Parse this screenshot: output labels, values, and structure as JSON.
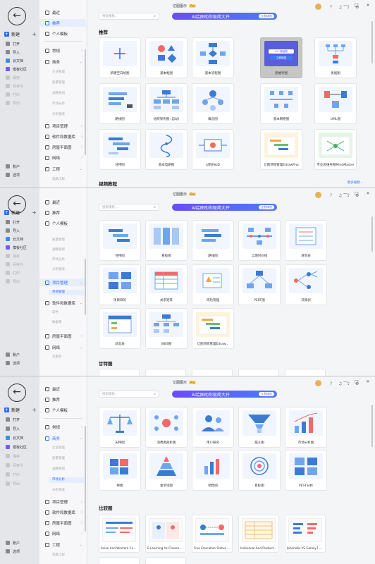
{
  "window": {
    "title": "亿图图示",
    "pro_badge": "Pro"
  },
  "rail": {
    "back_glyph": "←",
    "new_label": "新建",
    "new_plus": "+",
    "items": [
      {
        "label": "打开"
      },
      {
        "label": "导入"
      },
      {
        "label": "云文档"
      },
      {
        "label": "模板社区"
      },
      {
        "label": "保存"
      },
      {
        "label": "另存为"
      },
      {
        "label": "打印"
      },
      {
        "label": "导出"
      }
    ],
    "account": "账户",
    "options": "选项"
  },
  "nav": {
    "recent": "最近",
    "recommend": "推荐",
    "personal": "个人模板",
    "general": "常规",
    "business": "商务",
    "business_subs": [
      "企业管理",
      "质量管理",
      "战略规划",
      "市场分析",
      "分析图表"
    ],
    "project": "项目管理",
    "project_subs": [
      "项目管理"
    ],
    "software": "软件和数据库",
    "software_subs": [
      "软件",
      "数据库"
    ],
    "floor": "房屋平面图",
    "network": "网络",
    "network_subs": [
      "云服务"
    ],
    "engineering": "工程",
    "engineering_subs": [
      "电路工程"
    ]
  },
  "search": {
    "placeholder": "搜索模板...",
    "icon": "search-icon"
  },
  "banner": {
    "text": "AI绘图助你极简大开",
    "button": "立即体验",
    "colors": [
      "#6b4df6",
      "#4a7cf9"
    ]
  },
  "toolbar": {
    "icons": [
      "help-icon",
      "notification-icon",
      "share-icon",
      "settings-icon"
    ]
  },
  "window_controls": {
    "minimize": "—",
    "maximize": "□",
    "close": "✕"
  },
  "panel1": {
    "heading": "推荐",
    "cards": [
      {
        "label": "新建空白绘图"
      },
      {
        "label": "基本框图"
      },
      {
        "label": "基本流程图"
      },
      {
        "label": "思维导图",
        "overlay1": "AI一键画图",
        "overlay2": "立即新建"
      },
      {
        "label": "发展图"
      },
      {
        "label": "路线图"
      },
      {
        "label": "组织架构图 (自动)"
      },
      {
        "label": "概念图"
      },
      {
        "label": "基本网络图"
      },
      {
        "label": "UML图"
      },
      {
        "label": "甘特图"
      },
      {
        "label": "基本电路图"
      },
      {
        "label": "过程P&ID"
      },
      {
        "label": "亿图项目管理EdrawProj"
      },
      {
        "label": "专业思维导图MindMaster"
      }
    ],
    "section2": "视频教程",
    "more": "更多视频 ›"
  },
  "panel2": {
    "cards": [
      {
        "label": "甘特图"
      },
      {
        "label": "看板图"
      },
      {
        "label": "路线图"
      },
      {
        "label": "工期时间线"
      },
      {
        "label": "清单表"
      },
      {
        "label": "项目目的"
      },
      {
        "label": "关系矩阵"
      },
      {
        "label": "风险管理"
      },
      {
        "label": "PERT图"
      },
      {
        "label": "决策树"
      },
      {
        "label": "状态表"
      },
      {
        "label": "WBS图"
      },
      {
        "label": "亿图项目管理Edraw..."
      }
    ],
    "section2": "甘特图",
    "badge_new": "新"
  },
  "panel3": {
    "cards": [
      {
        "label": "天秤图"
      },
      {
        "label": "消费者剖析图"
      },
      {
        "label": "用户研究"
      },
      {
        "label": "漏斗图"
      },
      {
        "label": "市场分析图"
      },
      {
        "label": "拼图"
      },
      {
        "label": "金字塔图"
      },
      {
        "label": "销售图"
      },
      {
        "label": "目标图"
      },
      {
        "label": "PEST分析"
      }
    ],
    "section2": "比较图",
    "templates": [
      {
        "label": "Asian And Western Cust..."
      },
      {
        "label": "E-Learning Vs Classroom..."
      },
      {
        "label": "Free Education Status C..."
      },
      {
        "label": "Individual And Product ..."
      },
      {
        "label": "Iphone6s VS Galaxy7 C..."
      }
    ]
  }
}
